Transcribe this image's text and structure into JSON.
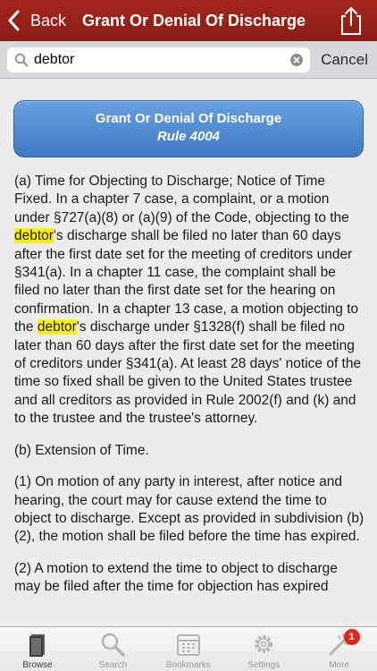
{
  "navbar": {
    "back_label": "Back",
    "title": "Grant Or Denial Of Discharge",
    "share_icon": "share-icon",
    "color": "#961f16"
  },
  "search": {
    "value": "debtor",
    "placeholder": "",
    "cancel_label": "Cancel"
  },
  "rule_header": {
    "title": "Grant Or Denial Of Discharge",
    "number": "Rule 4004",
    "color": "#4a86d0"
  },
  "paragraphs": [
    {
      "segments": [
        "(a) Time for Objecting to Discharge; Notice of Time Fixed. In a chapter 7 case, a complaint, or a motion under §727(a)(8) or (a)(9) of the Code, objecting to the ",
        "debtor",
        "'s discharge shall be filed no later than 60 days after the first date set for the meeting of creditors under §341(a). In a chapter 11 case, the complaint shall be filed no later than the first date set for the hearing on confirmation. In a chapter 13 case, a motion objecting to the ",
        "debtor",
        "'s discharge under §1328(f) shall be filed no later than 60 days after the first date set for the meeting of creditors under §341(a). At least 28 days' notice of the time so fixed shall be given to the United States trustee and all creditors as provided in Rule 2002(f) and (k) and to the trustee and the trustee's attorney."
      ]
    },
    {
      "segments": [
        "(b) Extension of Time."
      ]
    },
    {
      "segments": [
        "(1) On motion of any party in interest, after notice and hearing, the court may for cause extend the time to object to discharge. Except as provided in subdivision (b)(2), the motion shall be filed before the time has expired."
      ]
    },
    {
      "segments": [
        "(2) A motion to extend the time to object to discharge may be filed after the time for objection has expired"
      ]
    }
  ],
  "highlight_color": "#fff200",
  "tabbar": {
    "tabs": [
      {
        "label": "Browse",
        "icon": "book-icon",
        "active": true
      },
      {
        "label": "Search",
        "icon": "magnifier-icon",
        "active": false
      },
      {
        "label": "Bookmarks",
        "icon": "calendar-icon",
        "active": false
      },
      {
        "label": "Settings",
        "icon": "gear-icon",
        "active": false
      },
      {
        "label": "More",
        "icon": "magic-wand-icon",
        "active": false,
        "badge": "1"
      }
    ]
  }
}
